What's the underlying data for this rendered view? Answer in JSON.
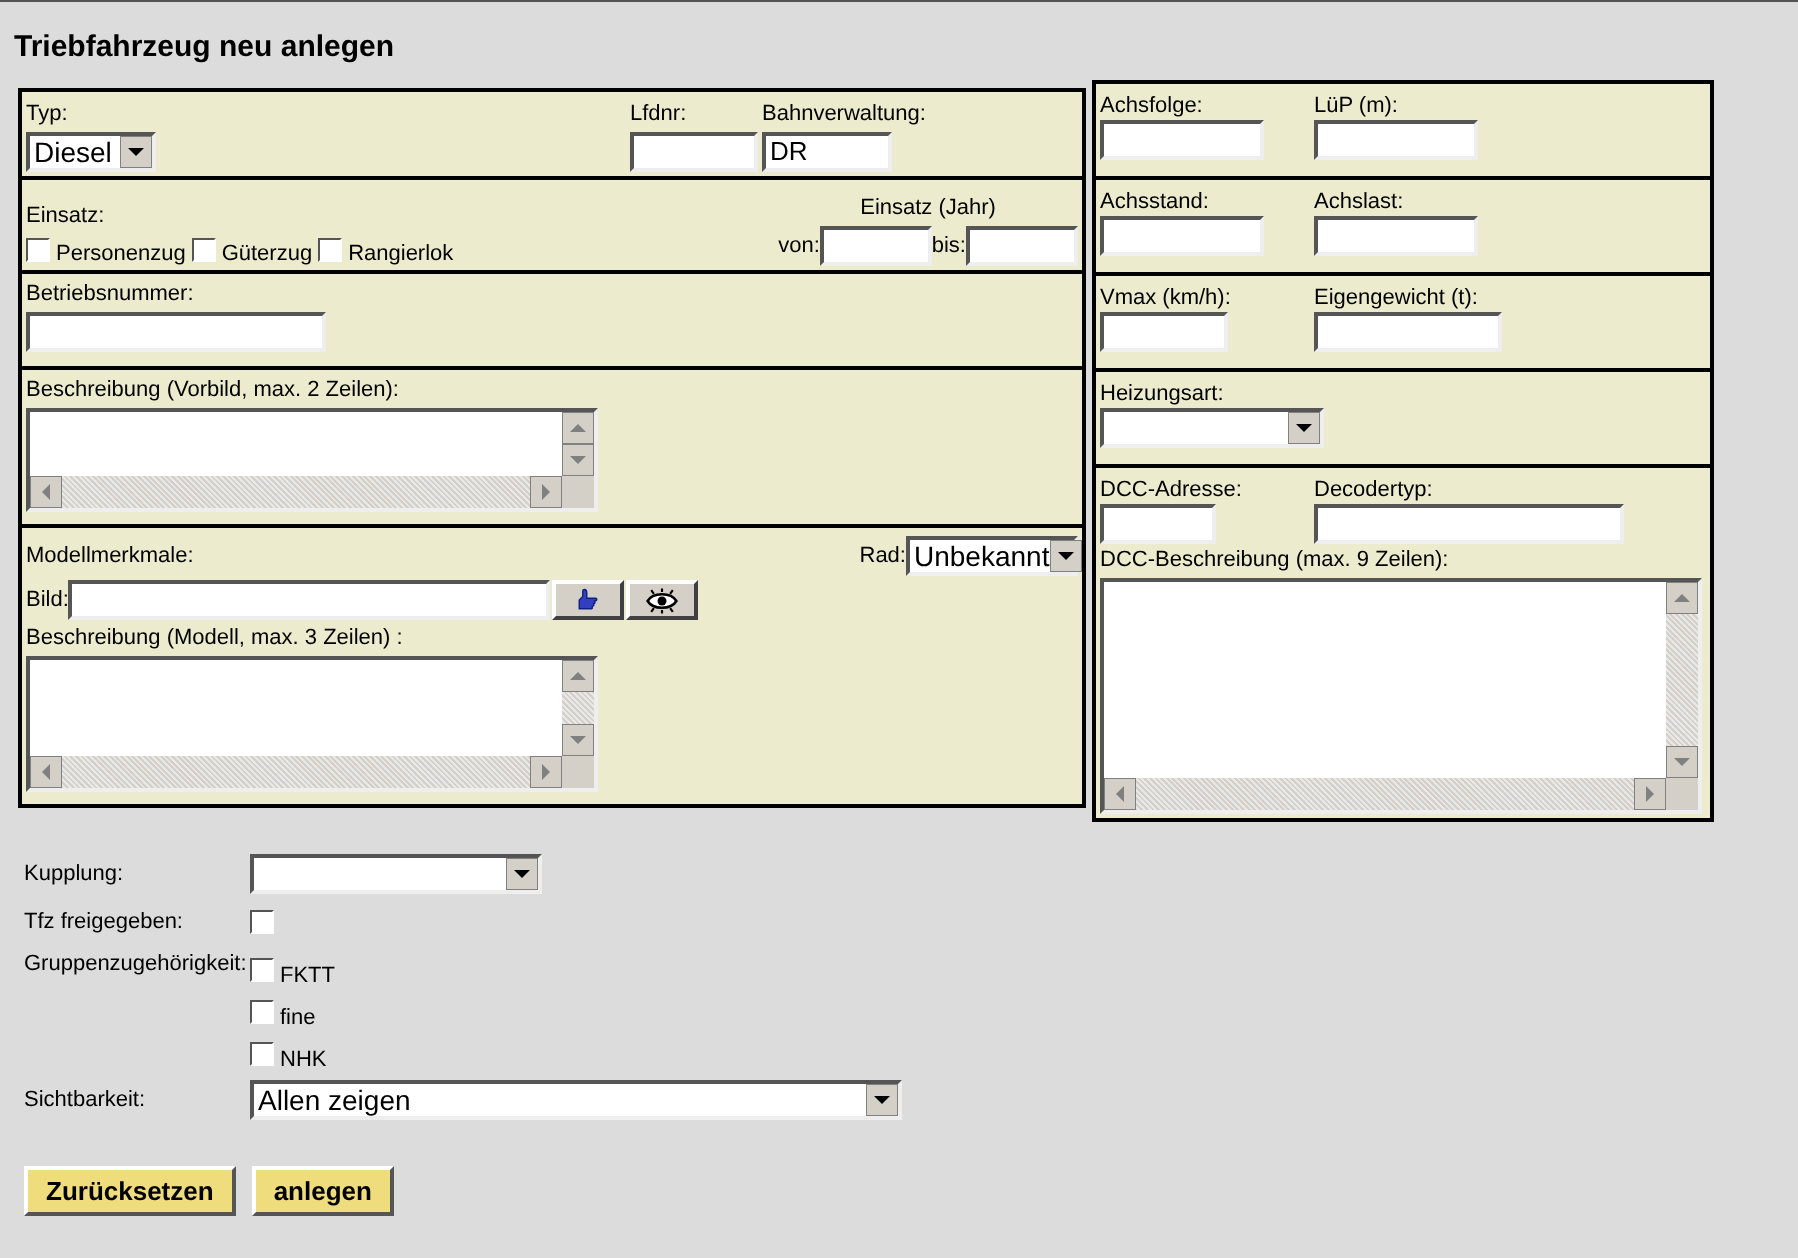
{
  "title": "Triebfahrzeug neu anlegen",
  "typ": {
    "label": "Typ:",
    "value": "Diesel"
  },
  "lfdnr": {
    "label": "Lfdnr:"
  },
  "bahnverwaltung": {
    "label": "Bahnverwaltung:",
    "value": "DR"
  },
  "einsatz": {
    "label": "Einsatz:",
    "options": [
      {
        "label": "Personenzug",
        "checked": false
      },
      {
        "label": "Güterzug",
        "checked": false
      },
      {
        "label": "Rangierlok",
        "checked": false
      }
    ]
  },
  "einsatz_jahr": {
    "label": "Einsatz (Jahr)",
    "from_label": "von:",
    "to_label": "bis:"
  },
  "betriebsnummer": {
    "label": "Betriebsnummer:"
  },
  "beschreibung_vorbild": {
    "label": "Beschreibung (Vorbild, max. 2 Zeilen):"
  },
  "modellmerkmale": {
    "label": "Modellmerkmale:"
  },
  "rad": {
    "label": "Rad:",
    "value": "Unbekannt"
  },
  "bild": {
    "label": "Bild:"
  },
  "beschreibung_modell": {
    "label": "Beschreibung (Modell, max. 3 Zeilen) :"
  },
  "right_sections": [
    {
      "fields": [
        {
          "kind": "text",
          "label": "Achsfolge:"
        },
        {
          "kind": "text",
          "label": "LüP (m):"
        }
      ]
    },
    {
      "fields": [
        {
          "kind": "text",
          "label": "Achsstand:"
        },
        {
          "kind": "text",
          "label": "Achslast:"
        }
      ]
    },
    {
      "fields": [
        {
          "kind": "text",
          "label": "Vmax (km/h):"
        },
        {
          "kind": "text",
          "label": "Eigengewicht (t):"
        }
      ]
    },
    {
      "fields": [
        {
          "kind": "select",
          "label": "Heizungsart:"
        }
      ]
    },
    {
      "fields": [
        {
          "kind": "text",
          "label": "DCC-Adresse:"
        },
        {
          "kind": "text",
          "label": "Decodertyp:"
        },
        {
          "kind": "textarea",
          "label": "DCC-Beschreibung (max. 9 Zeilen):"
        }
      ]
    }
  ],
  "kupplung": {
    "label": "Kupplung:"
  },
  "tfz_freigegeben": {
    "label": "Tfz freigegeben:",
    "checked": false
  },
  "gruppenzugehoerigkeit": {
    "label": "Gruppenzugehörigkeit:",
    "options": [
      {
        "label": "FKTT",
        "checked": false
      },
      {
        "label": "fine",
        "checked": false
      },
      {
        "label": "NHK",
        "checked": false
      }
    ]
  },
  "sichtbarkeit": {
    "label": "Sichtbarkeit:",
    "value": "Allen zeigen"
  },
  "buttons": [
    "Zurücksetzen",
    "anlegen"
  ]
}
